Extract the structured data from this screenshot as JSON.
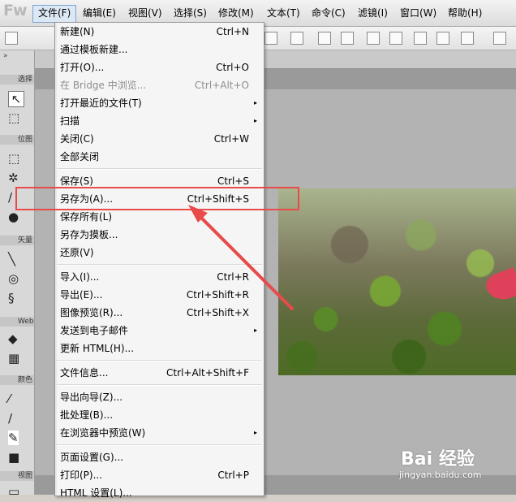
{
  "app": {
    "logo": "Fw"
  },
  "menubar": [
    {
      "label": "文件(F)",
      "active": true
    },
    {
      "label": "编辑(E)"
    },
    {
      "label": "视图(V)"
    },
    {
      "label": "选择(S)"
    },
    {
      "label": "修改(M)"
    },
    {
      "label": "文本(T)"
    },
    {
      "label": "命令(C)"
    },
    {
      "label": "滤镜(I)"
    },
    {
      "label": "窗口(W)"
    },
    {
      "label": "帮助(H)"
    }
  ],
  "tools": {
    "sections": [
      "选择",
      "位图",
      "矢量",
      "Web",
      "颜色",
      "视图"
    ],
    "collapse_icon": "double-chevron-icon"
  },
  "file_menu": {
    "items": [
      {
        "label": "新建(N)",
        "shortcut": "Ctrl+N"
      },
      {
        "label": "通过模板新建..."
      },
      {
        "label": "打开(O)...",
        "shortcut": "Ctrl+O"
      },
      {
        "label": "在 Bridge 中浏览...",
        "shortcut": "Ctrl+Alt+O",
        "disabled": true
      },
      {
        "label": "打开最近的文件(T)",
        "submenu": true
      },
      {
        "label": "扫描",
        "submenu": true
      },
      {
        "label": "关闭(C)",
        "shortcut": "Ctrl+W"
      },
      {
        "label": "全部关闭"
      },
      {
        "label": "保存(S)",
        "shortcut": "Ctrl+S"
      },
      {
        "label": "另存为(A)...",
        "shortcut": "Ctrl+Shift+S",
        "highlighted": true
      },
      {
        "label": "保存所有(L)"
      },
      {
        "label": "另存为摸板..."
      },
      {
        "label": "还原(V)"
      },
      {
        "label": "导入(I)...",
        "shortcut": "Ctrl+R"
      },
      {
        "label": "导出(E)...",
        "shortcut": "Ctrl+Shift+R"
      },
      {
        "label": "图像预览(R)...",
        "shortcut": "Ctrl+Shift+X"
      },
      {
        "label": "发送到电子邮件",
        "submenu": true
      },
      {
        "label": "更新 HTML(H)..."
      },
      {
        "label": "文件信息...",
        "shortcut": "Ctrl+Alt+Shift+F"
      },
      {
        "label": "导出向导(Z)..."
      },
      {
        "label": "批处理(B)..."
      },
      {
        "label": "在浏览器中预览(W)",
        "submenu": true
      },
      {
        "label": "页面设置(G)..."
      },
      {
        "label": "打印(P)...",
        "shortcut": "Ctrl+P"
      },
      {
        "label": "HTML 设置(L)..."
      }
    ],
    "submenu_arrow": "▸"
  },
  "annotation": {
    "highlight_color": "#e94a4a",
    "target": "另存为(A)..."
  },
  "watermark": {
    "brand": "Bai 经验",
    "url": "jingyan.baidu.com"
  }
}
